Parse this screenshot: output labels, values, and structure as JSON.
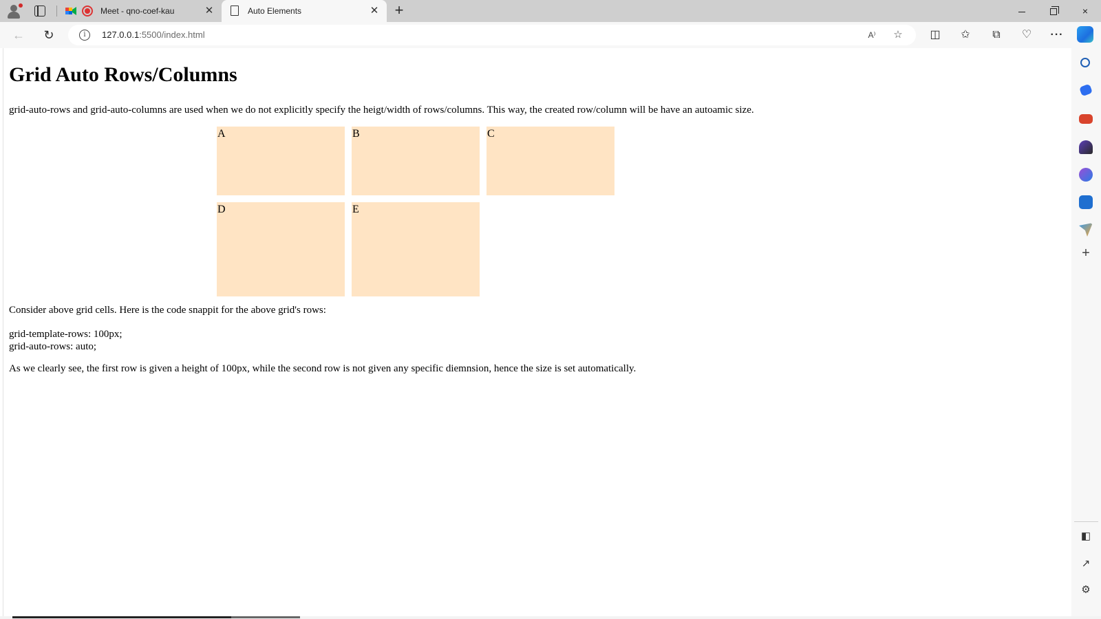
{
  "tabs": [
    {
      "title": "Meet - qno-coef-kau",
      "icon": "google-meet-icon",
      "status_icon": "recording-icon",
      "active": false
    },
    {
      "title": "Auto Elements",
      "icon": "page-icon",
      "active": true
    }
  ],
  "window": {
    "new_tab": "+",
    "minimize": "minimize-icon",
    "maximize": "restore-icon",
    "close": "×"
  },
  "address_bar": {
    "host": "127.0.0.1",
    "path": ":5500/index.html"
  },
  "page": {
    "heading": "Grid Auto Rows/Columns",
    "description": "grid-auto-rows and grid-auto-columns are used when we do not explicitly specify the heigt/width of rows/columns. This way, the created row/column will be have an autoamic size.",
    "grid": {
      "cells": [
        "A",
        "B",
        "C",
        "D",
        "E"
      ],
      "cell_color": "#ffe4c4"
    },
    "consider": "Consider above grid cells. Here is the code snappit for the above grid's rows:",
    "code_lines": [
      "grid-template-rows: 100px;",
      "grid-auto-rows: auto;"
    ],
    "explanation": "As we clearly see, the first row is given a height of 100px, while the second row is not given any specific diemnsion, hence the size is set automatically."
  },
  "sidebar": {
    "icons": [
      "search-icon",
      "shopping-icon",
      "tools-icon",
      "games-icon",
      "office-icon",
      "outlook-icon",
      "send-icon",
      "add-icon",
      "sidebar-panel-icon",
      "external-link-icon",
      "settings-icon"
    ]
  }
}
